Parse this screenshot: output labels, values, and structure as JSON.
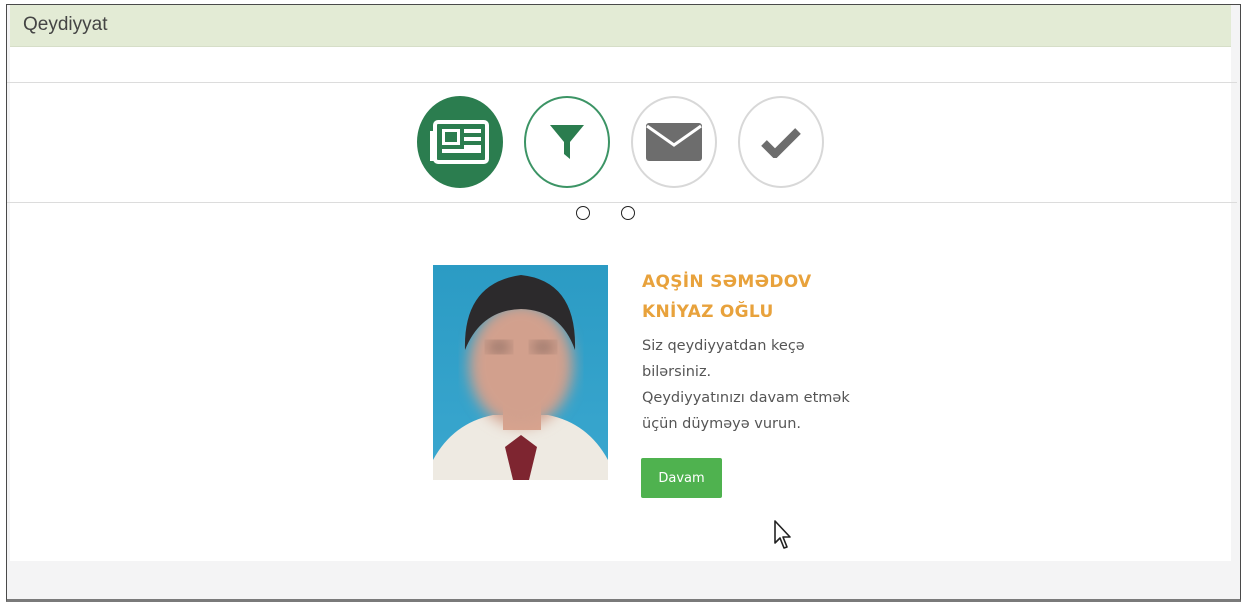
{
  "panel": {
    "title": "Qeydiyyat"
  },
  "steps": [
    {
      "icon": "newspaper-icon",
      "state": "completed"
    },
    {
      "icon": "filter-icon",
      "state": "current"
    },
    {
      "icon": "envelope-icon",
      "state": "pending"
    },
    {
      "icon": "checkmark-icon",
      "state": "pending"
    }
  ],
  "pagination": {
    "count": 2
  },
  "person": {
    "name_line1": "AQŞİN SƏMƏDOV",
    "name_line2": "KNİYAZ OĞLU"
  },
  "message": {
    "line1": "Siz qeydiyyatdan keçə",
    "line2": "bilərsiniz.",
    "line3": "Qeydiyyatınızı davam etmək",
    "line4": "üçün düyməyə vurun."
  },
  "actions": {
    "continue_label": "Davam"
  },
  "colors": {
    "header_bg": "#e3ebd5",
    "step_active": "#2b7d4f",
    "name_accent": "#e8a23c",
    "button_bg": "#4fb24f",
    "icon_gray": "#6d6d6d"
  }
}
